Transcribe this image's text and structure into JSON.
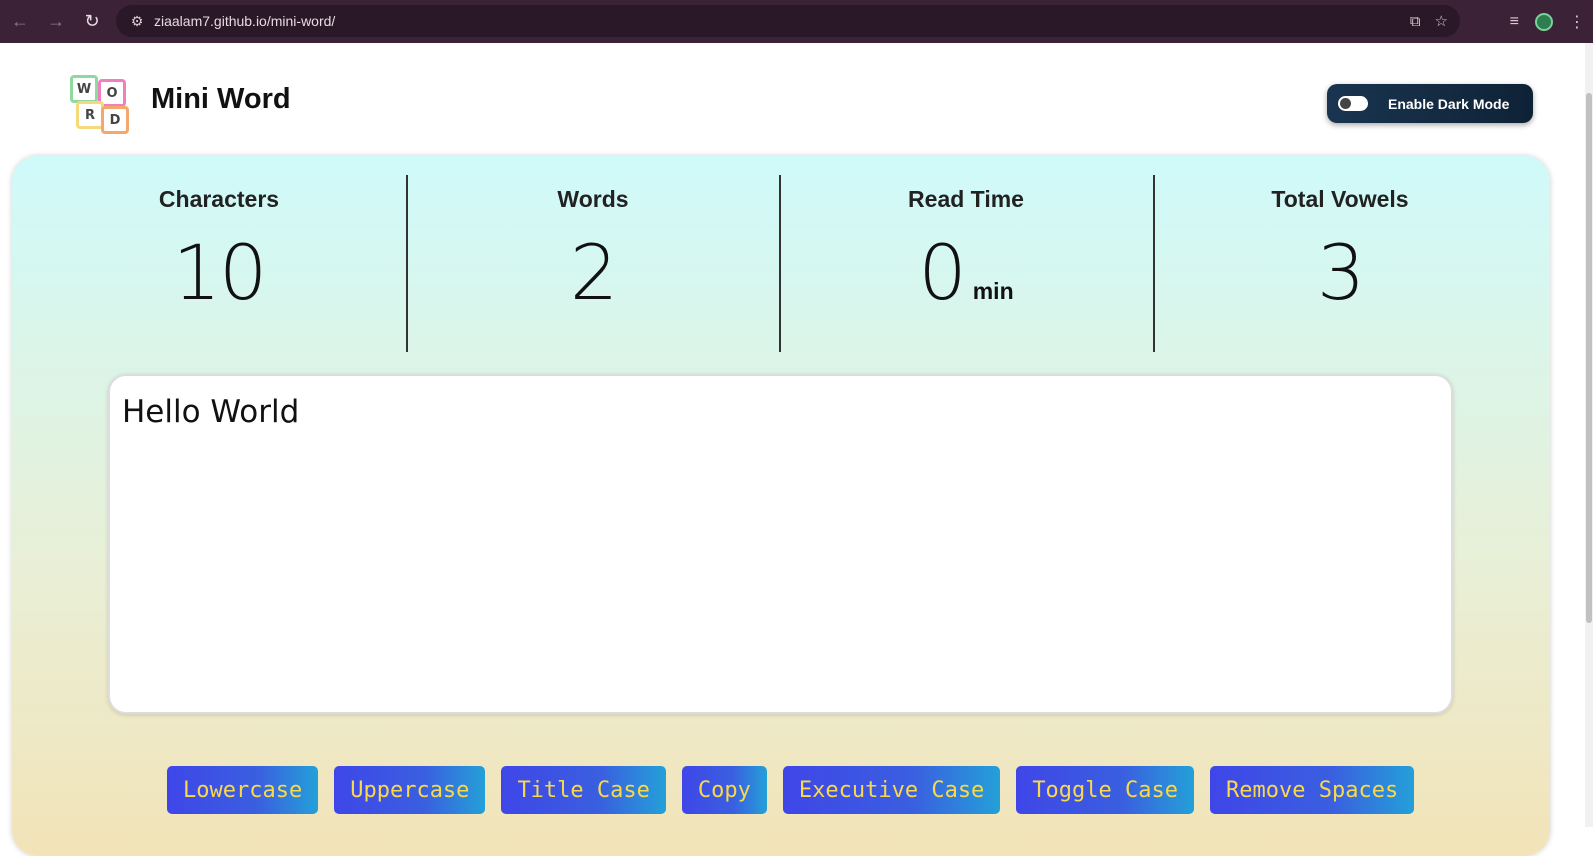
{
  "browser": {
    "url": "ziaalam7.github.io/mini-word/"
  },
  "header": {
    "logo_letters": [
      "W",
      "O",
      "R",
      "D"
    ],
    "title": "Mini Word",
    "dark_mode_label": "Enable Dark Mode"
  },
  "stats": [
    {
      "label": "Characters",
      "value": "10",
      "unit": ""
    },
    {
      "label": "Words",
      "value": "2",
      "unit": ""
    },
    {
      "label": "Read Time",
      "value": "0",
      "unit": "min"
    },
    {
      "label": "Total Vowels",
      "value": "3",
      "unit": ""
    }
  ],
  "editor": {
    "text": "Hello World"
  },
  "actions": [
    "Lowercase",
    "Uppercase",
    "Title Case",
    "Copy",
    "Executive Case",
    "Toggle Case",
    "Remove Spaces"
  ],
  "colors": {
    "button_text": "#f9d94a",
    "button_bg": "#3f46e8",
    "browser_bar": "#3b2236"
  }
}
